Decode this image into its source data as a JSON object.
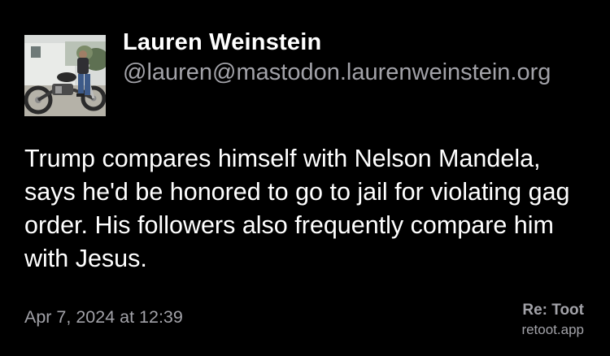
{
  "post": {
    "author_name": "Lauren Weinstein",
    "author_handle": "@lauren@mastodon.laurenweinstein.org",
    "avatar_icon": "motorcycle-rider-photo",
    "text": "Trump compares himself with Nelson Mandela, says he'd be honored to go to jail for violating gag order. His followers also frequently compare him with Jesus.",
    "timestamp": "Apr 7, 2024 at 12:39"
  },
  "branding": {
    "name": "Re: Toot",
    "url": "retoot.app"
  },
  "colors": {
    "background": "#000000",
    "primary_text": "#ffffff",
    "secondary_text": "#a2a2a8"
  }
}
